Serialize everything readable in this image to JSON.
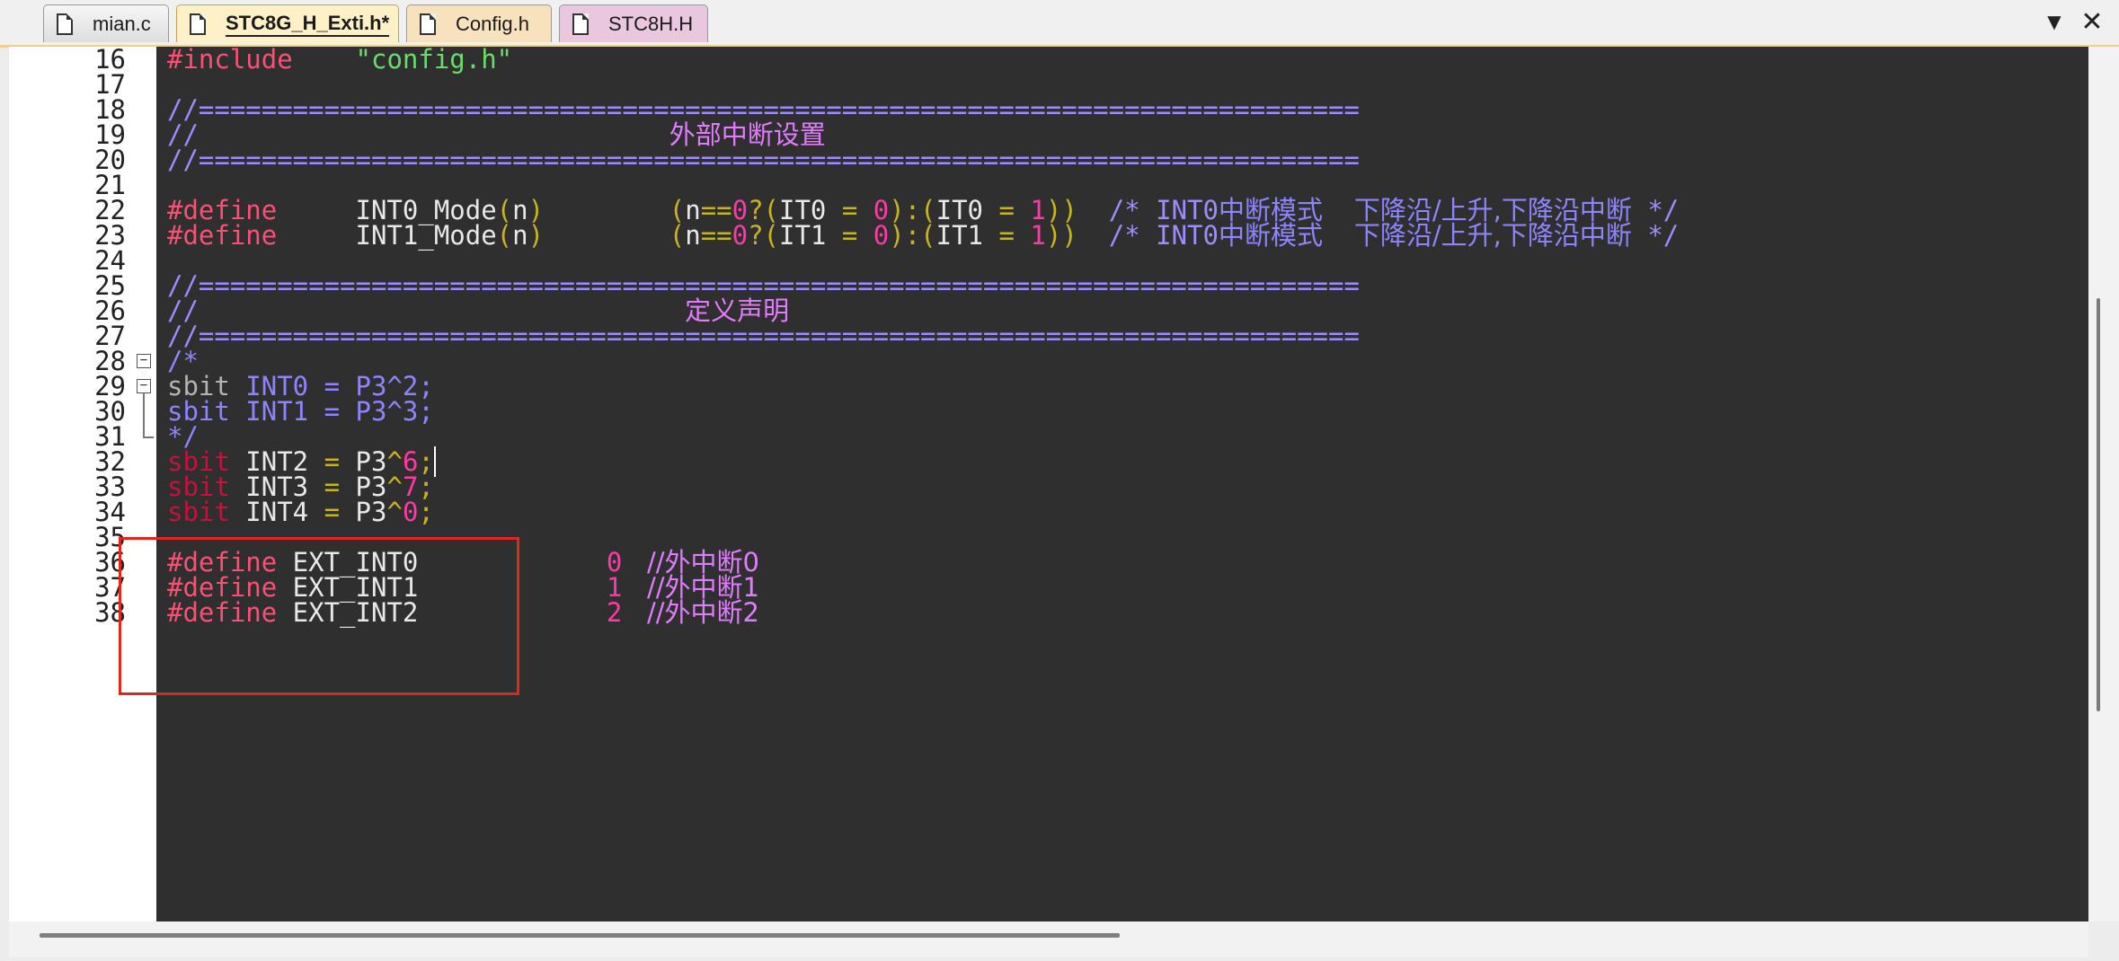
{
  "tabs": [
    {
      "label": "mian.c",
      "icon": "file-icon"
    },
    {
      "label": "STC8G_H_Exti.h*",
      "icon": "file-icon",
      "active": true
    },
    {
      "label": "Config.h",
      "icon": "file-icon"
    },
    {
      "label": "STC8H.H",
      "icon": "file-icon"
    }
  ],
  "window_buttons": {
    "dropdown": "▼",
    "close": "✕"
  },
  "colors": {
    "editor_background": "#2f2f2f",
    "preprocessor": "#ff4f74",
    "string": "#6bdc6b",
    "comment": "#9b8cff",
    "comment_cjk": "#e07cff",
    "number": "#ff3aa6",
    "punctuation": "#c8b41e",
    "highlight_box": "#e0261d",
    "active_tab": "#fff1c7"
  },
  "lines": [
    {
      "num": "16",
      "parts": [
        {
          "t": "#include",
          "c": "pre"
        },
        {
          "t": "    ",
          "c": "ident"
        },
        {
          "t": "\"config.h\"",
          "c": "str"
        }
      ]
    },
    {
      "num": "17",
      "parts": []
    },
    {
      "num": "18",
      "parts": [
        {
          "t": "//==========================================================================",
          "c": "cmt"
        }
      ]
    },
    {
      "num": "19",
      "parts": [
        {
          "t": "//                              ",
          "c": "cmt"
        },
        {
          "t": "外部中断设置",
          "c": "cjk"
        }
      ]
    },
    {
      "num": "20",
      "parts": [
        {
          "t": "//==========================================================================",
          "c": "cmt"
        }
      ]
    },
    {
      "num": "21",
      "parts": []
    },
    {
      "num": "22",
      "parts": [
        {
          "t": "#define",
          "c": "pre"
        },
        {
          "t": "     INT0_Mode",
          "c": "ident"
        },
        {
          "t": "(",
          "c": "punc"
        },
        {
          "t": "n",
          "c": "ident"
        },
        {
          "t": ")",
          "c": "punc"
        },
        {
          "t": "        ",
          "c": "ident"
        },
        {
          "t": "(",
          "c": "punc"
        },
        {
          "t": "n",
          "c": "ident"
        },
        {
          "t": "==",
          "c": "punc"
        },
        {
          "t": "0",
          "c": "num"
        },
        {
          "t": "?(",
          "c": "punc"
        },
        {
          "t": "IT0",
          "c": "ident"
        },
        {
          "t": " = ",
          "c": "punc"
        },
        {
          "t": "0",
          "c": "num"
        },
        {
          "t": "):(",
          "c": "punc"
        },
        {
          "t": "IT0",
          "c": "ident"
        },
        {
          "t": " = ",
          "c": "punc"
        },
        {
          "t": "1",
          "c": "num"
        },
        {
          "t": "))",
          "c": "punc"
        },
        {
          "t": "  /* INT0",
          "c": "cmt"
        },
        {
          "t": "中断模式",
          "c": "cjk-cmt"
        },
        {
          "t": "  ",
          "c": "cmt"
        },
        {
          "t": "下降沿/上升,下降沿中断",
          "c": "cjk-cmt"
        },
        {
          "t": " */",
          "c": "cmt"
        }
      ]
    },
    {
      "num": "23",
      "parts": [
        {
          "t": "#define",
          "c": "pre"
        },
        {
          "t": "     INT1_Mode",
          "c": "ident"
        },
        {
          "t": "(",
          "c": "punc"
        },
        {
          "t": "n",
          "c": "ident"
        },
        {
          "t": ")",
          "c": "punc"
        },
        {
          "t": "        ",
          "c": "ident"
        },
        {
          "t": "(",
          "c": "punc"
        },
        {
          "t": "n",
          "c": "ident"
        },
        {
          "t": "==",
          "c": "punc"
        },
        {
          "t": "0",
          "c": "num"
        },
        {
          "t": "?(",
          "c": "punc"
        },
        {
          "t": "IT1",
          "c": "ident"
        },
        {
          "t": " = ",
          "c": "punc"
        },
        {
          "t": "0",
          "c": "num"
        },
        {
          "t": "):(",
          "c": "punc"
        },
        {
          "t": "IT1",
          "c": "ident"
        },
        {
          "t": " = ",
          "c": "punc"
        },
        {
          "t": "1",
          "c": "num"
        },
        {
          "t": "))",
          "c": "punc"
        },
        {
          "t": "  /* INT0",
          "c": "cmt"
        },
        {
          "t": "中断模式",
          "c": "cjk-cmt"
        },
        {
          "t": "  ",
          "c": "cmt"
        },
        {
          "t": "下降沿/上升,下降沿中断",
          "c": "cjk-cmt"
        },
        {
          "t": " */",
          "c": "cmt"
        }
      ]
    },
    {
      "num": "24",
      "parts": []
    },
    {
      "num": "25",
      "parts": [
        {
          "t": "//==========================================================================",
          "c": "cmt"
        }
      ]
    },
    {
      "num": "26",
      "parts": [
        {
          "t": "//                               ",
          "c": "cmt"
        },
        {
          "t": "定义声明",
          "c": "cjk"
        }
      ]
    },
    {
      "num": "27",
      "parts": [
        {
          "t": "//==========================================================================",
          "c": "cmt"
        }
      ]
    },
    {
      "num": "28",
      "parts": [
        {
          "t": "/*",
          "c": "blue"
        }
      ]
    },
    {
      "num": "29",
      "parts": [
        {
          "t": "sbit",
          "c": "grey"
        },
        {
          "t": " INT0 = P3^2;",
          "c": "blue"
        }
      ]
    },
    {
      "num": "30",
      "parts": [
        {
          "t": "sbit INT1 = P3^3;",
          "c": "blue"
        }
      ]
    },
    {
      "num": "31",
      "parts": [
        {
          "t": "*/",
          "c": "blue"
        }
      ]
    },
    {
      "num": "32",
      "parts": [
        {
          "t": "sbit",
          "c": "kw"
        },
        {
          "t": " INT2 ",
          "c": "ident"
        },
        {
          "t": "=",
          "c": "punc"
        },
        {
          "t": " P3",
          "c": "ident"
        },
        {
          "t": "^",
          "c": "punc"
        },
        {
          "t": "6",
          "c": "num"
        },
        {
          "t": ";",
          "c": "punc"
        }
      ]
    },
    {
      "num": "33",
      "parts": [
        {
          "t": "sbit",
          "c": "kw"
        },
        {
          "t": " INT3 ",
          "c": "ident"
        },
        {
          "t": "=",
          "c": "punc"
        },
        {
          "t": " P3",
          "c": "ident"
        },
        {
          "t": "^",
          "c": "punc"
        },
        {
          "t": "7",
          "c": "num"
        },
        {
          "t": ";",
          "c": "punc"
        }
      ]
    },
    {
      "num": "34",
      "parts": [
        {
          "t": "sbit",
          "c": "kw"
        },
        {
          "t": " INT4 ",
          "c": "ident"
        },
        {
          "t": "=",
          "c": "punc"
        },
        {
          "t": " P3",
          "c": "ident"
        },
        {
          "t": "^",
          "c": "punc"
        },
        {
          "t": "0",
          "c": "num"
        },
        {
          "t": ";",
          "c": "punc"
        }
      ]
    },
    {
      "num": "35",
      "parts": []
    },
    {
      "num": "36",
      "parts": [
        {
          "t": "#define",
          "c": "pre"
        },
        {
          "t": " EXT_INT0            ",
          "c": "ident"
        },
        {
          "t": "0",
          "c": "num"
        },
        {
          "t": "   //",
          "c": "cjk"
        },
        {
          "t": "外中断0",
          "c": "cjk"
        }
      ]
    },
    {
      "num": "37",
      "parts": [
        {
          "t": "#define",
          "c": "pre"
        },
        {
          "t": " EXT_INT1            ",
          "c": "ident"
        },
        {
          "t": "1",
          "c": "num"
        },
        {
          "t": "   //",
          "c": "cjk"
        },
        {
          "t": "外中断1",
          "c": "cjk"
        }
      ]
    },
    {
      "num": "38",
      "parts": [
        {
          "t": "#define",
          "c": "pre"
        },
        {
          "t": " EXT_INT2            ",
          "c": "ident"
        },
        {
          "t": "2",
          "c": "num"
        },
        {
          "t": "   //",
          "c": "cjk"
        },
        {
          "t": "外中断2",
          "c": "cjk"
        }
      ]
    }
  ]
}
